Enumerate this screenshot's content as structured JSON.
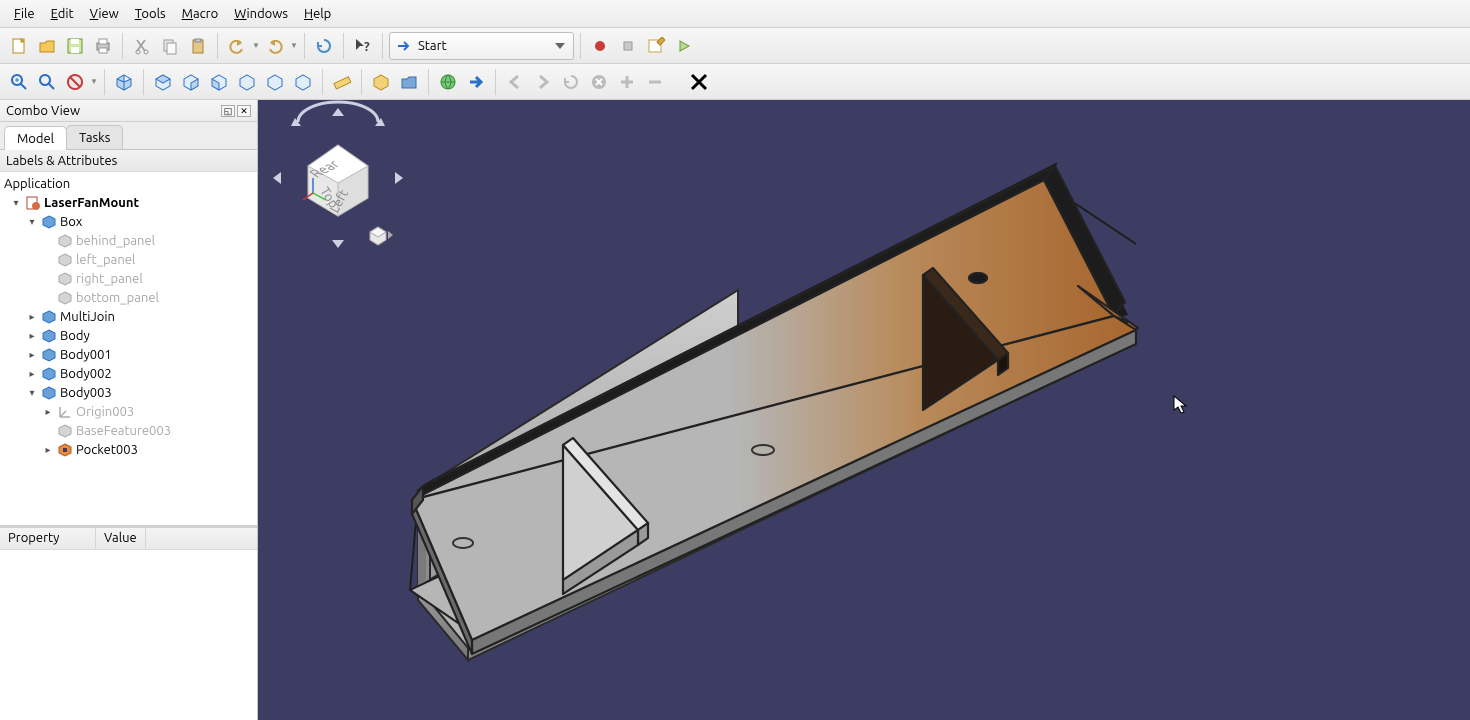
{
  "menu": {
    "file": "File",
    "edit": "Edit",
    "view": "View",
    "tools": "Tools",
    "macro": "Macro",
    "windows": "Windows",
    "help": "Help"
  },
  "workspace": {
    "selected": "Start"
  },
  "combo": {
    "title": "Combo View",
    "tabs": {
      "model": "Model",
      "tasks": "Tasks"
    },
    "section": "Labels & Attributes",
    "root": "Application",
    "doc": "LaserFanMount",
    "tree": {
      "box": "Box",
      "behind_panel": "behind_panel",
      "left_panel": "left_panel",
      "right_panel": "right_panel",
      "bottom_panel": "bottom_panel",
      "multijoin": "MultiJoin",
      "body": "Body",
      "body001": "Body001",
      "body002": "Body002",
      "body003": "Body003",
      "origin003": "Origin003",
      "basefeature003": "BaseFeature003",
      "pocket003": "Pocket003"
    },
    "prop": {
      "property": "Property",
      "value": "Value"
    }
  },
  "navcube": {
    "top": "Top",
    "rear": "Rear",
    "left": "Left"
  },
  "colors": {
    "viewport_bg": "#3d3d63",
    "part_grey": "#b6b6b6",
    "part_dark": "#8d8d8d",
    "wood_light": "#d49a5e",
    "wood_dark": "#a8672f"
  }
}
